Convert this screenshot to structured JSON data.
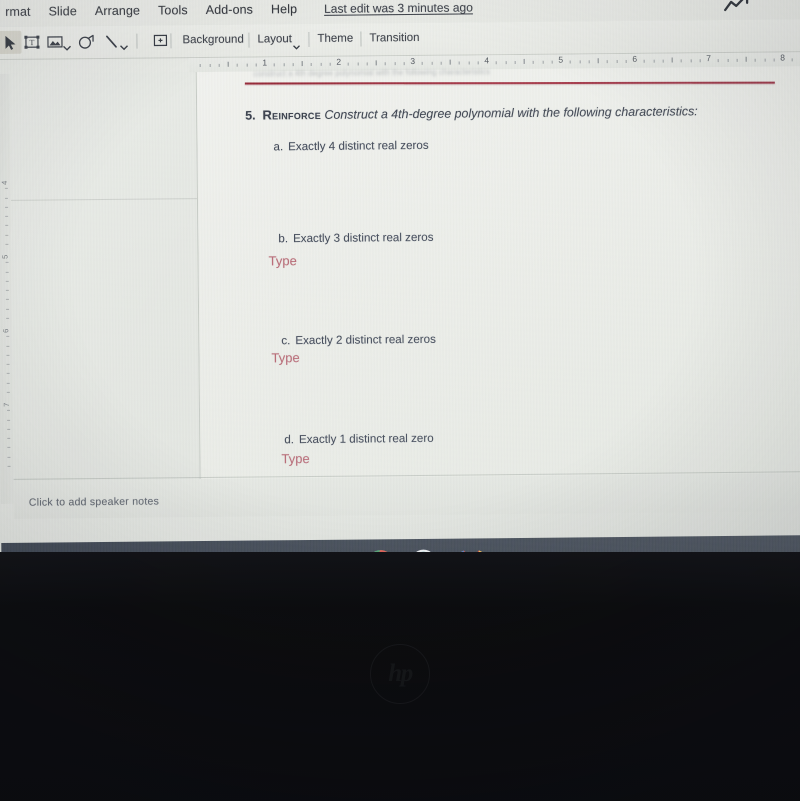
{
  "app": {
    "name": "Google Slides",
    "menu_items": [
      "rmat",
      "Slide",
      "Arrange",
      "Tools",
      "Add-ons",
      "Help"
    ],
    "last_edit": "Last edit was 3 minutes ago",
    "trend_icon": "trending-up-icon"
  },
  "toolbar": {
    "icons": [
      {
        "name": "select-cursor-icon",
        "selected": true
      },
      {
        "name": "text-box-icon",
        "selected": false
      },
      {
        "name": "insert-image-icon",
        "selected": false
      },
      {
        "name": "shape-icon",
        "selected": false
      },
      {
        "name": "line-icon",
        "selected": false
      },
      {
        "name": "add-comment-icon",
        "selected": false
      }
    ],
    "background_label": "Background",
    "layout_label": "Layout",
    "theme_label": "Theme",
    "transition_label": "Transition"
  },
  "ruler": {
    "horizontal_marks": [
      "1",
      "2",
      "3",
      "4",
      "5",
      "6",
      "7",
      "8"
    ],
    "vertical_marks": [
      "4",
      "5",
      "6",
      "7"
    ]
  },
  "slide": {
    "question_number": "5.",
    "keyword": "Reinforce",
    "prompt": "Construct a 4th-degree polynomial with the following characteristics:",
    "items": [
      {
        "label": "a.",
        "text": "Exactly 4 distinct real zeros",
        "answer": ""
      },
      {
        "label": "b.",
        "text": "Exactly 3 distinct real zeros",
        "answer": "Type"
      },
      {
        "label": "c.",
        "text": "Exactly 2 distinct real zeros",
        "answer": "Type"
      },
      {
        "label": "d.",
        "text": "Exactly 1 distinct real zero",
        "answer": "Type"
      }
    ],
    "accent_rule_color": "#9a2c3c",
    "answer_color": "#b4626e"
  },
  "notes": {
    "placeholder": "Click to add speaker notes"
  },
  "shelf": {
    "apps": [
      {
        "name": "chrome-icon",
        "label": "Chrome",
        "active": true
      },
      {
        "name": "google-meet-icon",
        "label": "Google Meet",
        "active": false
      },
      {
        "name": "gmail-icon",
        "label": "Gmail",
        "active": false
      }
    ],
    "background_color": "#39414d"
  },
  "bezel": {
    "brand": "hp"
  }
}
